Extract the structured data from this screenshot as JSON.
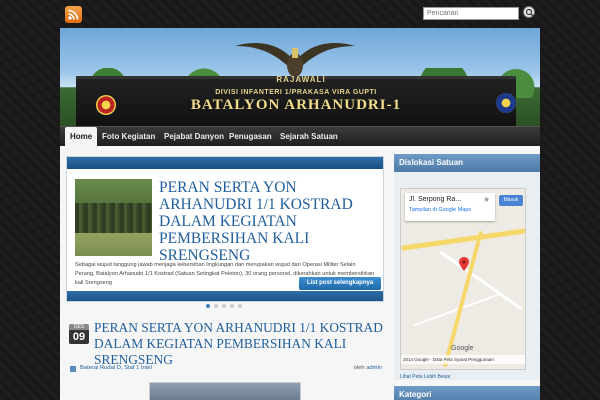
{
  "topbar": {
    "search_placeholder": "Pencarian"
  },
  "banner": {
    "plate": "RAJAWALI",
    "line1": "DIVISI INFANTERI 1/PRAKASA VIRA GUPTI",
    "line2": "BATALYON ARHANUDRI-1"
  },
  "nav": {
    "items": [
      {
        "label": "Home",
        "active": true
      },
      {
        "label": "Foto Kegiatan"
      },
      {
        "label": "Pejabat Danyon"
      },
      {
        "label": "Penugasan"
      },
      {
        "label": "Sejarah Satuan"
      }
    ]
  },
  "slider": {
    "title": "PERAN SERTA YON ARHANUDRI 1/1 KOSTRAD DALAM KEGIATAN PEMBERSIHAN KALI SRENGSENG",
    "excerpt": "Sebagai wujud tanggung jawab menjaga kebersihan lingkungan dan merupakan wujud dari Operasi Militer Selain Perang, Batalyon Arhanudri 1/1 Kostrad (Satuan Setingkat Peleton), 30 orang personel, dikerahkan untuk membersihkan kali Srengseng",
    "more_label": "List post selengkapnya"
  },
  "post": {
    "month": "DES",
    "day": "09",
    "title": "PERAN SERTA YON ARHANUDRI 1/1 KOSTRAD DALAM KEGIATAN PEMBERSIHAN KALI SRENGSENG",
    "categories": "Baterai Rudal D, Staf 1 Intel",
    "by_prefix": "oleh",
    "author": "admin"
  },
  "sidebar": {
    "dislokasi_title": "Dislokasi Satuan",
    "map": {
      "card_title": "Jl. Serpong Ra...",
      "card_link": "Tampilan di Google Maps",
      "signin": "Masuk",
      "credit": "2014 Google - Data Peta Syarat Penggunaan",
      "logo": "Google"
    },
    "larger_map": "Lihat Peta Lebih Besar",
    "kategori_title": "Kategori"
  },
  "colors": {
    "accent_blue": "#1f5e9c",
    "widget_header": "#5a86b3",
    "nav_bg": "#2a2a2a"
  }
}
